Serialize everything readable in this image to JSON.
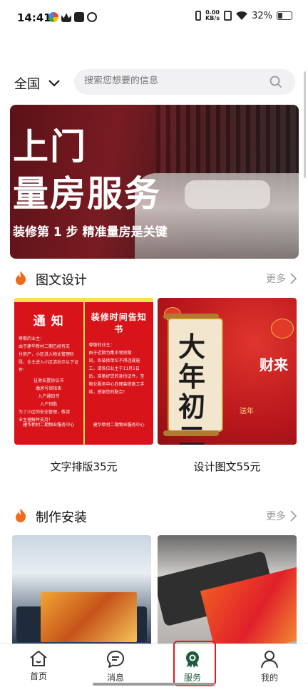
{
  "status_bar": {
    "time": "14:41",
    "speed_value": "0.00",
    "speed_unit": "KB/s",
    "battery": "32%"
  },
  "header": {
    "region": "全国",
    "search_placeholder": "搜索您想要的信息"
  },
  "banner": {
    "title_line1": "上门",
    "title_line2": "量房服务",
    "subtitle": "装修第 1 步 精准量房是关键"
  },
  "sections": [
    {
      "title": "图文设计",
      "more": "更多",
      "items": [
        {
          "label": "文字排版35元",
          "poster": {
            "left_title": "通 知",
            "left_lines": [
              "尊敬的业主：",
              "由于建华新村二期已经有支",
              "付房产，小区进入物业管理阶",
              "段，业主进入小区请出示以下证",
              "件：",
              "征收安置协议书",
              "缴房号审核表",
              "入户通知书",
              "入户钥匙",
              "为了小区的安全管理，敬请",
              "业主理解并支持！"
            ],
            "left_foot": "建华新村二期物业服务中心",
            "right_title": "装修时间告知书",
            "right_lines": [
              "尊敬的业主：",
              "由于近期为集中领房期",
              "间，各装修单位不得违规施",
              "工，请各位业主于11月1日",
              "后，准备好您的身份证件，至",
              "物业服务中心办理装修施工手",
              "续，感谢您的配合！"
            ],
            "right_foot": "建华新村二期物业服务中心"
          }
        },
        {
          "label": "设计图文55元",
          "poster": {
            "scroll_text": "大年初二",
            "right_text": "财来",
            "small_text": "送年"
          }
        }
      ]
    },
    {
      "title": "制作安装",
      "more": "更多",
      "items": [
        {
          "label": ""
        },
        {
          "label": ""
        }
      ]
    }
  ],
  "nav": [
    {
      "label": "首页",
      "icon": "home-icon"
    },
    {
      "label": "消息",
      "icon": "message-icon"
    },
    {
      "label": "服务",
      "icon": "service-icon"
    },
    {
      "label": "我的",
      "icon": "profile-icon"
    }
  ],
  "colors": {
    "accent": "#1e5b3a",
    "fire": "#f06a1b",
    "highlight_box": "#e21b23",
    "poster_red": "#d8141a"
  }
}
